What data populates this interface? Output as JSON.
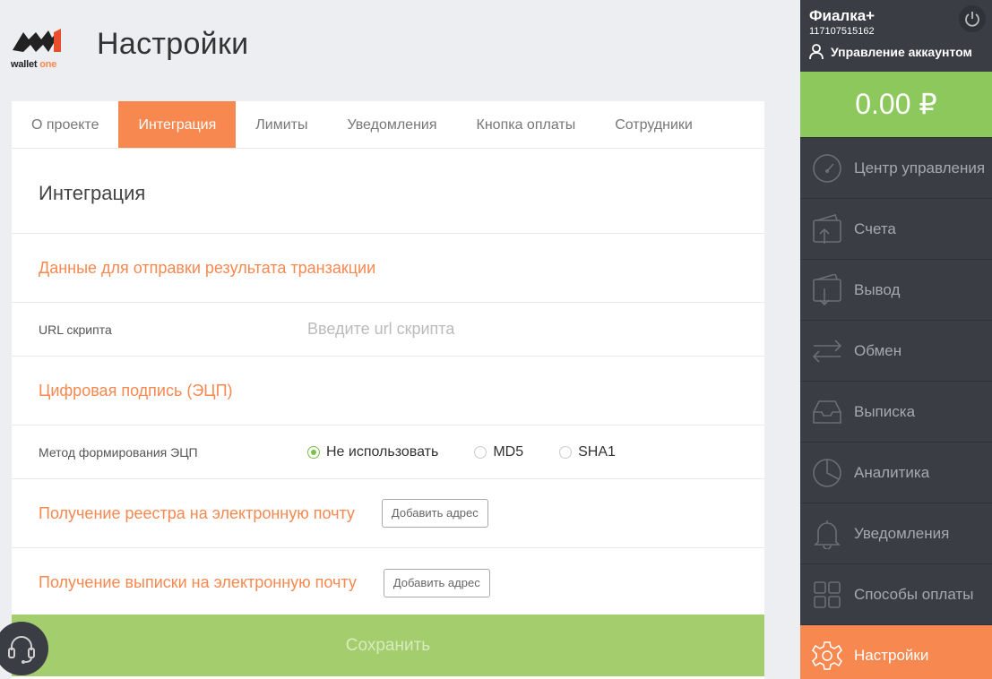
{
  "brand": {
    "logo_text_main": "wallet ",
    "logo_text_accent": "one"
  },
  "page_title": "Настройки",
  "tabs": [
    {
      "label": "О проекте",
      "active": false
    },
    {
      "label": "Интеграция",
      "active": true
    },
    {
      "label": "Лимиты",
      "active": false
    },
    {
      "label": "Уведомления",
      "active": false
    },
    {
      "label": "Кнопка оплаты",
      "active": false
    },
    {
      "label": "Сотрудники",
      "active": false
    }
  ],
  "section": {
    "heading": "Интеграция",
    "transaction_data_title": "Данные для отправки результата транзакции",
    "url_label": "URL скрипта",
    "url_value": "",
    "url_placeholder": "Введите url скрипта",
    "signature_title": "Цифровая подпись (ЭЦП)",
    "method_label": "Метод формирования ЭЦП",
    "methods": [
      {
        "label": "Не использовать",
        "checked": true
      },
      {
        "label": "MD5",
        "checked": false
      },
      {
        "label": "SHA1",
        "checked": false
      }
    ],
    "registry_title": "Получение реестра на электронную почту",
    "registry_button": "Добавить адрес",
    "statement_title": "Получение выписки на электронную почту",
    "statement_button": "Добавить адрес",
    "save_label": "Сохранить"
  },
  "account": {
    "name": "Фиалка+",
    "id": "117107515162",
    "manage_label": "Управление аккаунтом",
    "balance": "0.00 ₽"
  },
  "menu": [
    {
      "label": "Центр управления",
      "icon": "speedometer-icon"
    },
    {
      "label": "Счета",
      "icon": "wallet-in-icon"
    },
    {
      "label": "Вывод",
      "icon": "wallet-out-icon"
    },
    {
      "label": "Обмен",
      "icon": "exchange-arrows-icon"
    },
    {
      "label": "Выписка",
      "icon": "inbox-tray-icon"
    },
    {
      "label": "Аналитика",
      "icon": "pie-chart-icon"
    },
    {
      "label": "Уведомления",
      "icon": "bell-icon"
    },
    {
      "label": "Способы оплаты",
      "icon": "grid-icon"
    },
    {
      "label": "Настройки",
      "icon": "gear-icon",
      "active": true
    }
  ],
  "colors": {
    "accent": "#f7884f",
    "green": "#8dc85c",
    "save_green": "#a4cd6e",
    "sidebar": "#3a3d43"
  }
}
